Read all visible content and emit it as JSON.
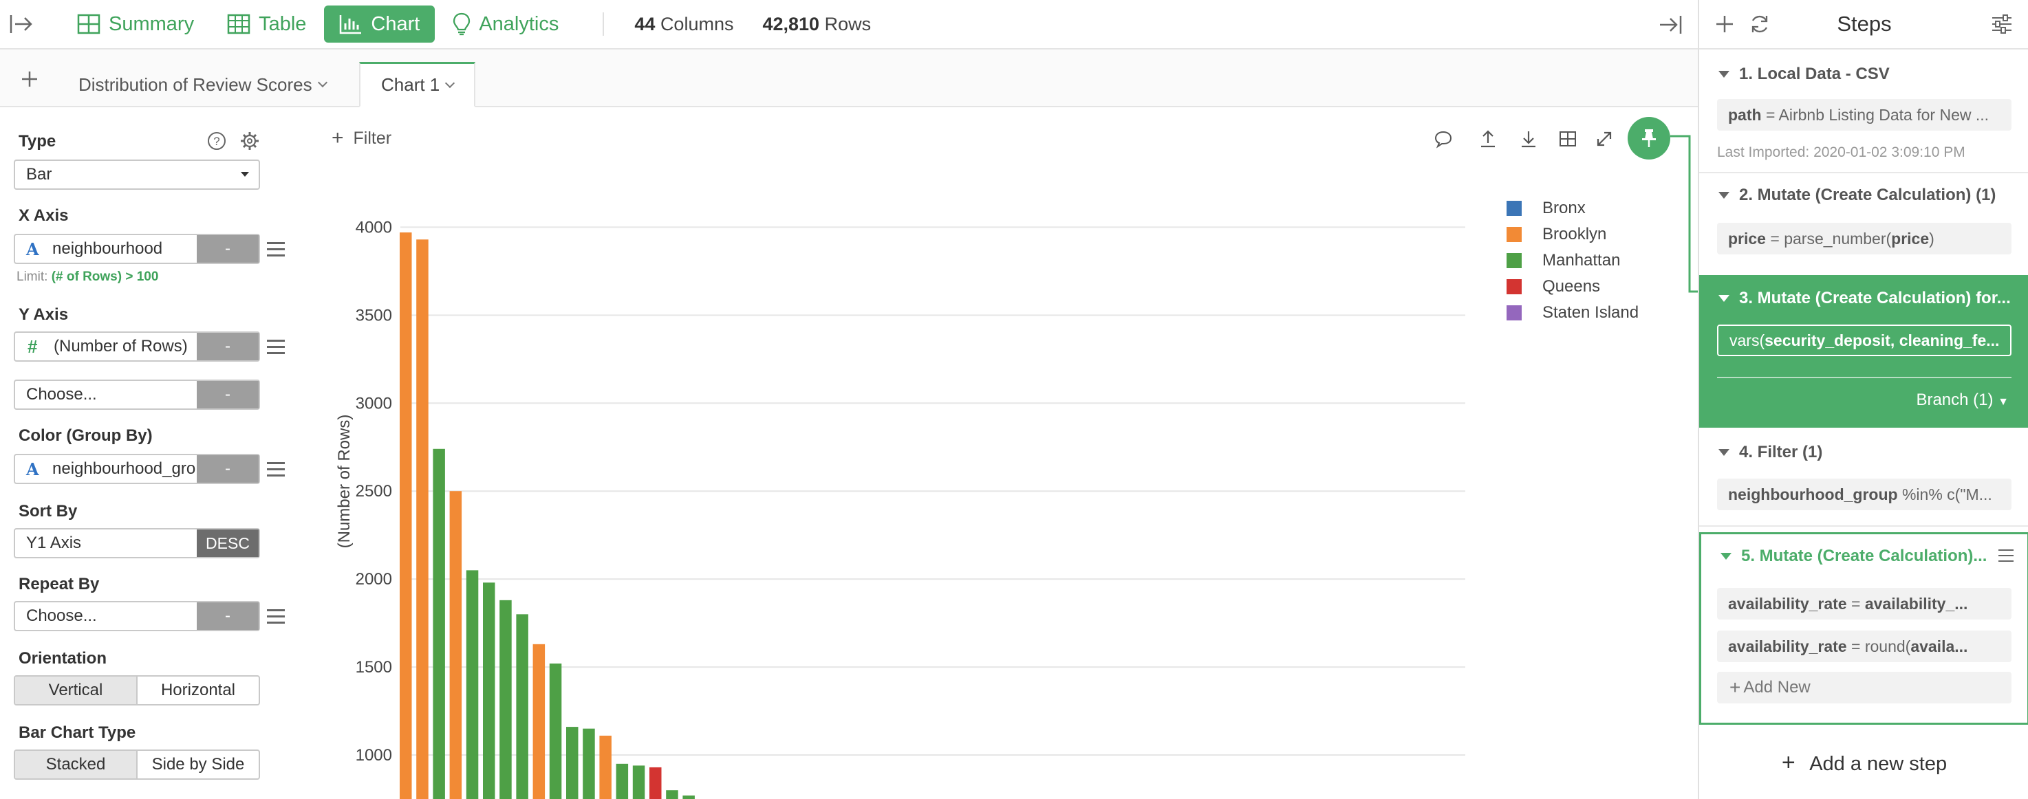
{
  "topbar": {
    "tabs": [
      {
        "label": "Summary",
        "icon": "summary-icon",
        "active": false
      },
      {
        "label": "Table",
        "icon": "table-icon",
        "active": false
      },
      {
        "label": "Chart",
        "icon": "chart-icon",
        "active": true
      },
      {
        "label": "Analytics",
        "icon": "lightbulb-icon",
        "active": false
      }
    ],
    "columns_count": "44",
    "columns_label": "Columns",
    "rows_count": "42,810",
    "rows_label": "Rows"
  },
  "chart_tabs": [
    {
      "label": "Distribution of Review Scores",
      "active": false
    },
    {
      "label": "Chart 1",
      "active": true
    }
  ],
  "config": {
    "type_label": "Type",
    "type_value": "Bar",
    "xaxis_label": "X Axis",
    "xaxis_value": "neighbourhood",
    "xaxis_agg": "-",
    "limit_prefix": "Limit:",
    "limit_value": "(# of Rows) > 100",
    "yaxis_label": "Y Axis",
    "yaxis_value": "(Number of Rows)",
    "yaxis_agg": "-",
    "yaxis2_value": "Choose...",
    "yaxis2_agg": "-",
    "color_label": "Color (Group By)",
    "color_value": "neighbourhood_gro",
    "color_agg": "-",
    "sort_label": "Sort By",
    "sort_value": "Y1 Axis",
    "sort_order": "DESC",
    "repeat_label": "Repeat By",
    "repeat_value": "Choose...",
    "repeat_agg": "-",
    "orientation_label": "Orientation",
    "orientation_options": [
      "Vertical",
      "Horizontal"
    ],
    "bartype_label": "Bar Chart Type",
    "bartype_options": [
      "Stacked",
      "Side by Side"
    ]
  },
  "chart_toolbar": {
    "filter_label": "Filter"
  },
  "chart_data": {
    "type": "bar",
    "ylabel": "(Number of Rows)",
    "ylim": [
      750,
      4150
    ],
    "yticks": [
      1000,
      1500,
      2000,
      2500,
      3000,
      3500,
      4000
    ],
    "legend": [
      {
        "name": "Bronx",
        "color": "#3b75b6"
      },
      {
        "name": "Brooklyn",
        "color": "#f28a35"
      },
      {
        "name": "Manhattan",
        "color": "#4ea046"
      },
      {
        "name": "Queens",
        "color": "#d33431"
      },
      {
        "name": "Staten Island",
        "color": "#9467bd"
      }
    ],
    "bars": [
      {
        "group": "Brooklyn",
        "value": 3970
      },
      {
        "group": "Brooklyn",
        "value": 3930
      },
      {
        "group": "Manhattan",
        "value": 2740
      },
      {
        "group": "Brooklyn",
        "value": 2500
      },
      {
        "group": "Manhattan",
        "value": 2050
      },
      {
        "group": "Manhattan",
        "value": 1980
      },
      {
        "group": "Manhattan",
        "value": 1880
      },
      {
        "group": "Manhattan",
        "value": 1800
      },
      {
        "group": "Brooklyn",
        "value": 1630
      },
      {
        "group": "Manhattan",
        "value": 1520
      },
      {
        "group": "Manhattan",
        "value": 1160
      },
      {
        "group": "Manhattan",
        "value": 1150
      },
      {
        "group": "Brooklyn",
        "value": 1110
      },
      {
        "group": "Manhattan",
        "value": 950
      },
      {
        "group": "Manhattan",
        "value": 940
      },
      {
        "group": "Queens",
        "value": 930
      },
      {
        "group": "Manhattan",
        "value": 800
      },
      {
        "group": "Manhattan",
        "value": 770
      }
    ]
  },
  "steps_panel": {
    "title": "Steps",
    "add_step_label": "Add a new step",
    "steps": [
      {
        "title": "1. Local Data - CSV",
        "args": [
          {
            "key": "path",
            "rest": " = Airbnb Listing Data for New ..."
          }
        ],
        "sub": "Last Imported: 2020-01-02 3:09:10 PM"
      },
      {
        "title": "2. Mutate (Create Calculation) (1)",
        "args": [
          {
            "key": "price",
            "rest": " = parse_number(",
            "key2": "price",
            "rest2": ")"
          }
        ]
      },
      {
        "title": "3. Mutate (Create Calculation) for...",
        "args": [
          {
            "pre": "vars(",
            "key": "security_deposit, cleaning_fe..."
          }
        ],
        "branch": "Branch (1)"
      },
      {
        "title": "4. Filter (1)",
        "args": [
          {
            "key": "neighbourhood_group",
            "rest": " %in% c(\"M..."
          }
        ]
      },
      {
        "title": "5. Mutate (Create Calculation)...",
        "args": [
          {
            "key": "availability_rate",
            "rest": " = ",
            "key2": "availability_..."
          },
          {
            "key": "availability_rate",
            "rest": " = round(",
            "key2": "availa..."
          }
        ],
        "add_new": "Add New"
      }
    ]
  }
}
